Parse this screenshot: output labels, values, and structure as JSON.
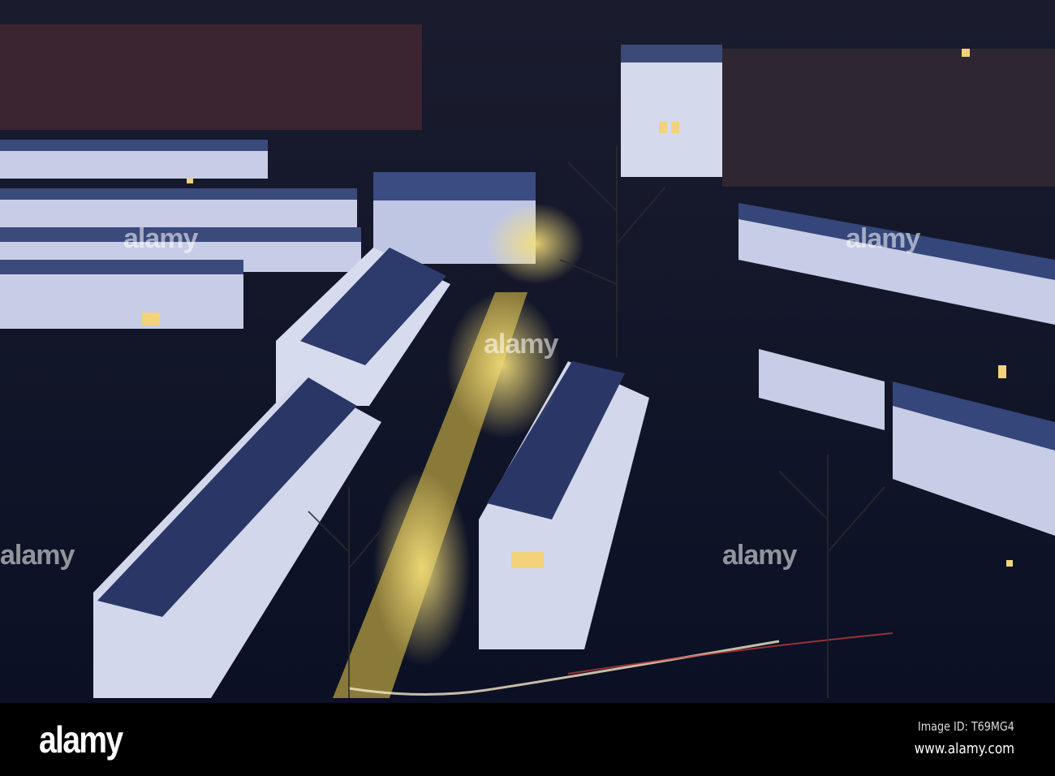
{
  "photo": {
    "subject": "aerial-night-housing-estate",
    "colors": {
      "sky": "#0d1630",
      "roof": "#2a3a6a",
      "wall": "#c9d0ea",
      "light": "#f3d66a"
    }
  },
  "watermark": {
    "text": "alamy"
  },
  "footer": {
    "logo": "alamy",
    "image_id": "Image ID: T69MG4",
    "website": "www.alamy.com"
  }
}
